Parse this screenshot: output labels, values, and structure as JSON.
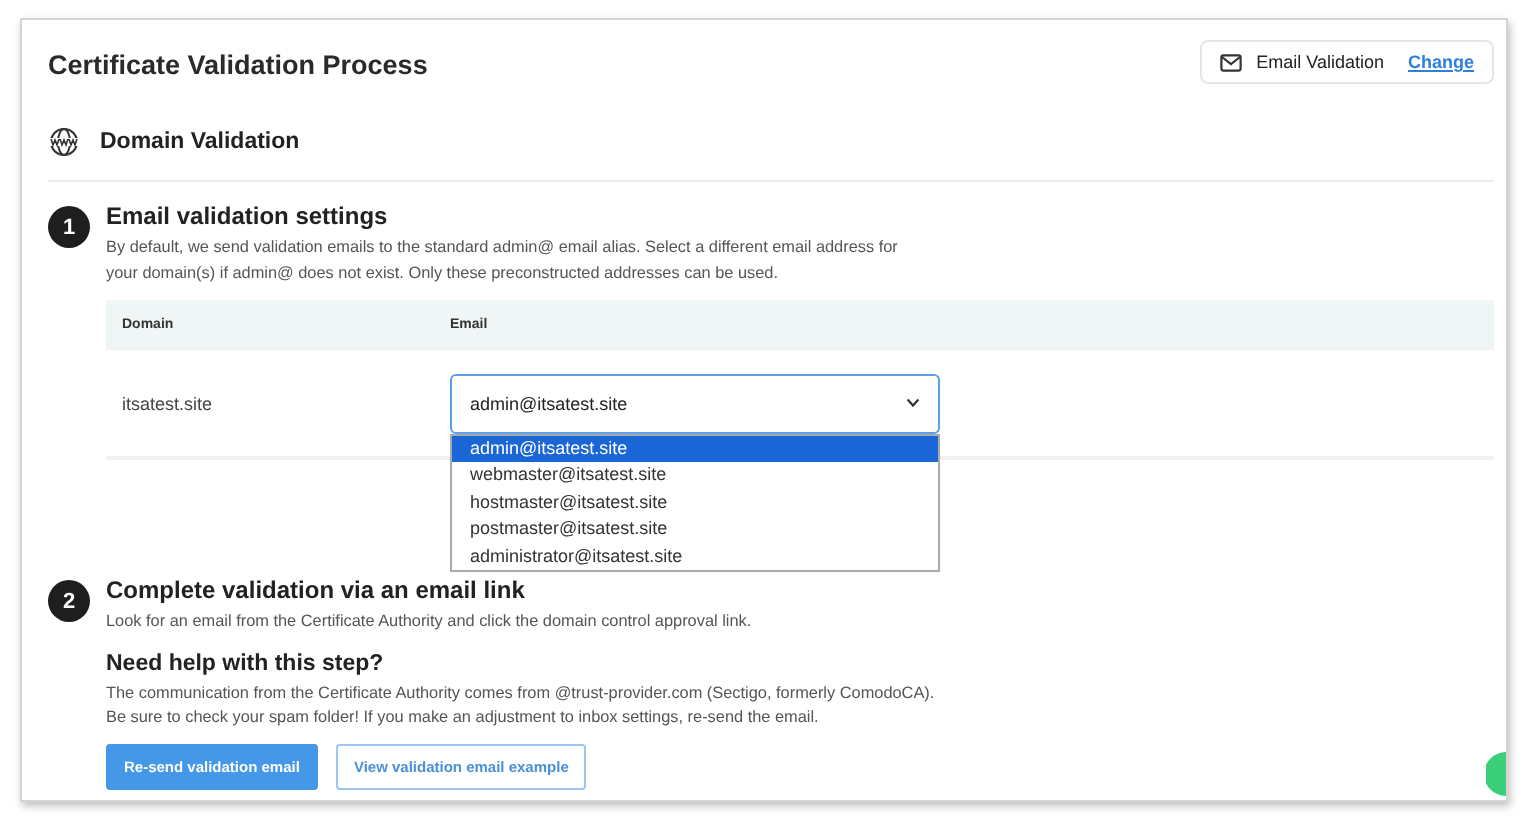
{
  "header": {
    "title": "Certificate Validation Process",
    "method": {
      "label": "Email Validation",
      "link": "Change"
    }
  },
  "section": {
    "title": "Domain Validation"
  },
  "steps": [
    {
      "number": "1",
      "title": "Email validation settings",
      "description": "By default, we send validation emails to the standard admin@ email alias. Select a different email address for your domain(s) if admin@ does not exist. Only these preconstructed addresses can be used.",
      "table": {
        "columns": [
          "Domain",
          "Email"
        ],
        "rows": [
          {
            "domain": "itsatest.site",
            "email": {
              "value": "admin@itsatest.site",
              "expanded": true,
              "options": [
                {
                  "label": "admin@itsatest.site",
                  "selected": true
                },
                {
                  "label": "webmaster@itsatest.site",
                  "selected": false
                },
                {
                  "label": "hostmaster@itsatest.site",
                  "selected": false
                },
                {
                  "label": "postmaster@itsatest.site",
                  "selected": false
                },
                {
                  "label": "administrator@itsatest.site",
                  "selected": false
                }
              ]
            }
          }
        ]
      }
    },
    {
      "number": "2",
      "title": "Complete validation via an email link",
      "description": "Look for an email from the Certificate Authority and click the domain control approval link."
    }
  ],
  "help": {
    "title": "Need help with this step?",
    "text": "The communication from the Certificate Authority comes from @trust-provider.com (Sectigo, formerly ComodoCA). Be sure to check your spam folder! If you make an adjustment to inbox settings, re-send the email.",
    "buttons": [
      {
        "label": "Re-send validation email",
        "kind": "primary"
      },
      {
        "label": "View validation email example",
        "kind": "outline"
      }
    ]
  }
}
